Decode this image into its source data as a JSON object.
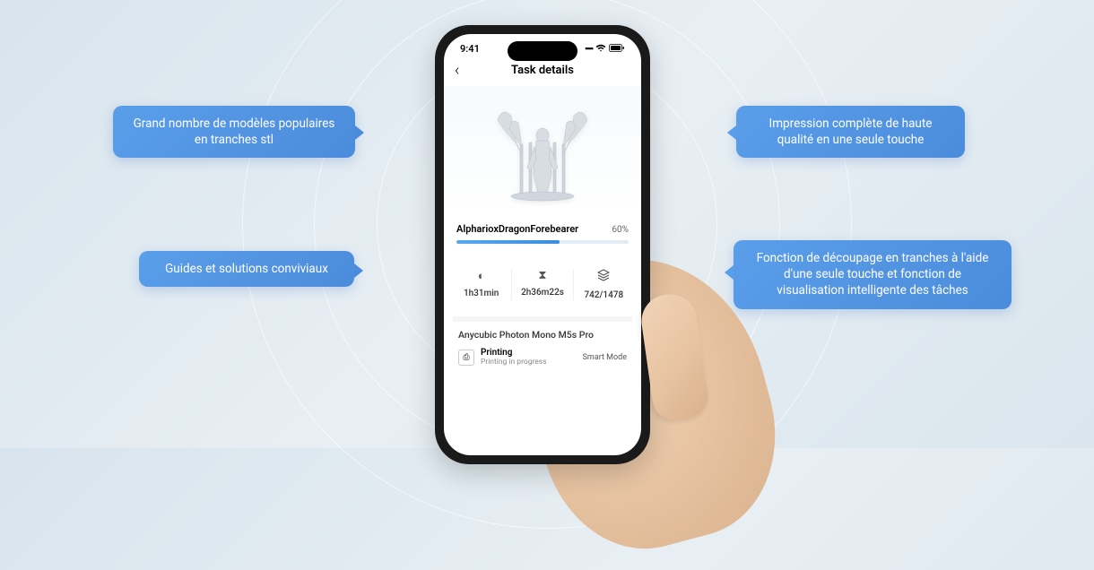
{
  "bubbles": {
    "top_left": "Grand nombre de modèles populaires en tranches stl",
    "top_right": "Impression complète de haute qualité en une seule touche",
    "bottom_left": "Guides et solutions conviviaux",
    "bottom_right": "Fonction de découpage en tranches à l'aide d'une seule touche et fonction de visualisation intelligente des tâches"
  },
  "phone": {
    "status": {
      "time": "9:41"
    },
    "header": {
      "title": "Task details"
    },
    "file": {
      "name": "AlpharioxDragonForebearer",
      "percent": "60%"
    },
    "stats": {
      "elapsed": "1h31min",
      "remaining": "2h36m22s",
      "layers": "742/1478"
    },
    "printer": {
      "name": "Anycubic Photon Mono M5s Pro",
      "status_title": "Printing",
      "status_sub": "Printing in progress",
      "mode": "Smart Mode"
    }
  }
}
